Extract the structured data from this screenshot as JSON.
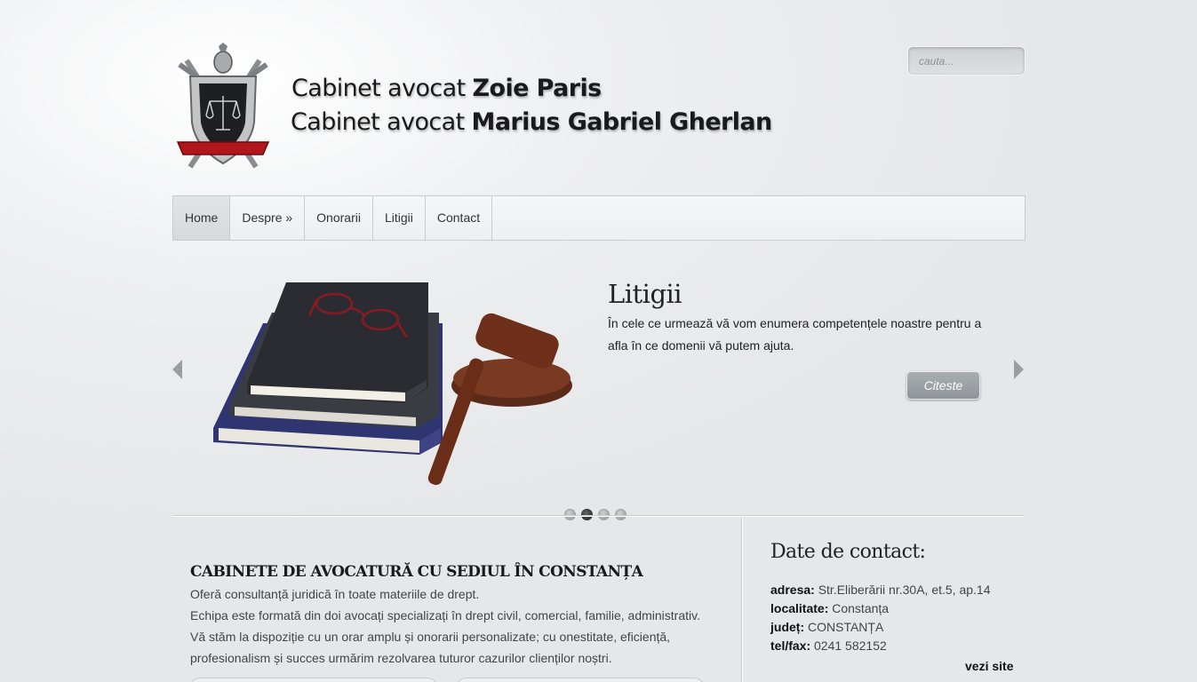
{
  "header": {
    "title_prefix": "Cabinet avocat",
    "lawyer1": "Zoie Paris",
    "lawyer2": "Marius Gabriel Gherlan",
    "search_placeholder": "cauta...",
    "logo_icon": "knight-shield-scales-logo"
  },
  "nav": {
    "items": [
      {
        "label": "Home"
      },
      {
        "label": "Despre »"
      },
      {
        "label": "Onorarii"
      },
      {
        "label": "Litigii"
      },
      {
        "label": "Contact"
      }
    ]
  },
  "slider": {
    "title": "Litigii",
    "text": "În cele ce urmează vă vom enumera competențele noastre pentru a afla în ce domenii vă putem ajuta.",
    "button": "Citeste",
    "image": "law-books-glasses-gavel",
    "dots": 4,
    "active_dot": 2
  },
  "main": {
    "heading": "CABINETE DE AVOCATURĂ CU SEDIUL ÎN CONSTANȚA",
    "lines": [
      "Oferă consultanță juridică în toate materiile de drept.",
      "Echipa este formată din doi avocați specializați în drept civil, comercial, familie, administrativ.",
      "Vă stăm la dispoziție cu un orar amplu și onorarii personalizate; cu onestitate, eficiență,",
      "profesionalism și succes urmărim rezolvarea tuturor cazurilor clienților noștri."
    ]
  },
  "contact": {
    "heading": "Date de contact:",
    "address_label": "adresa:",
    "address": "Str.Eliberării nr.30A, et.5, ap.14",
    "city_label": "localitate:",
    "city": "Constanța",
    "county_label": "județ:",
    "county": "CONSTANȚA",
    "phone_label": "tel/fax:",
    "phone": "0241 582152",
    "see_site": "vezi site"
  }
}
